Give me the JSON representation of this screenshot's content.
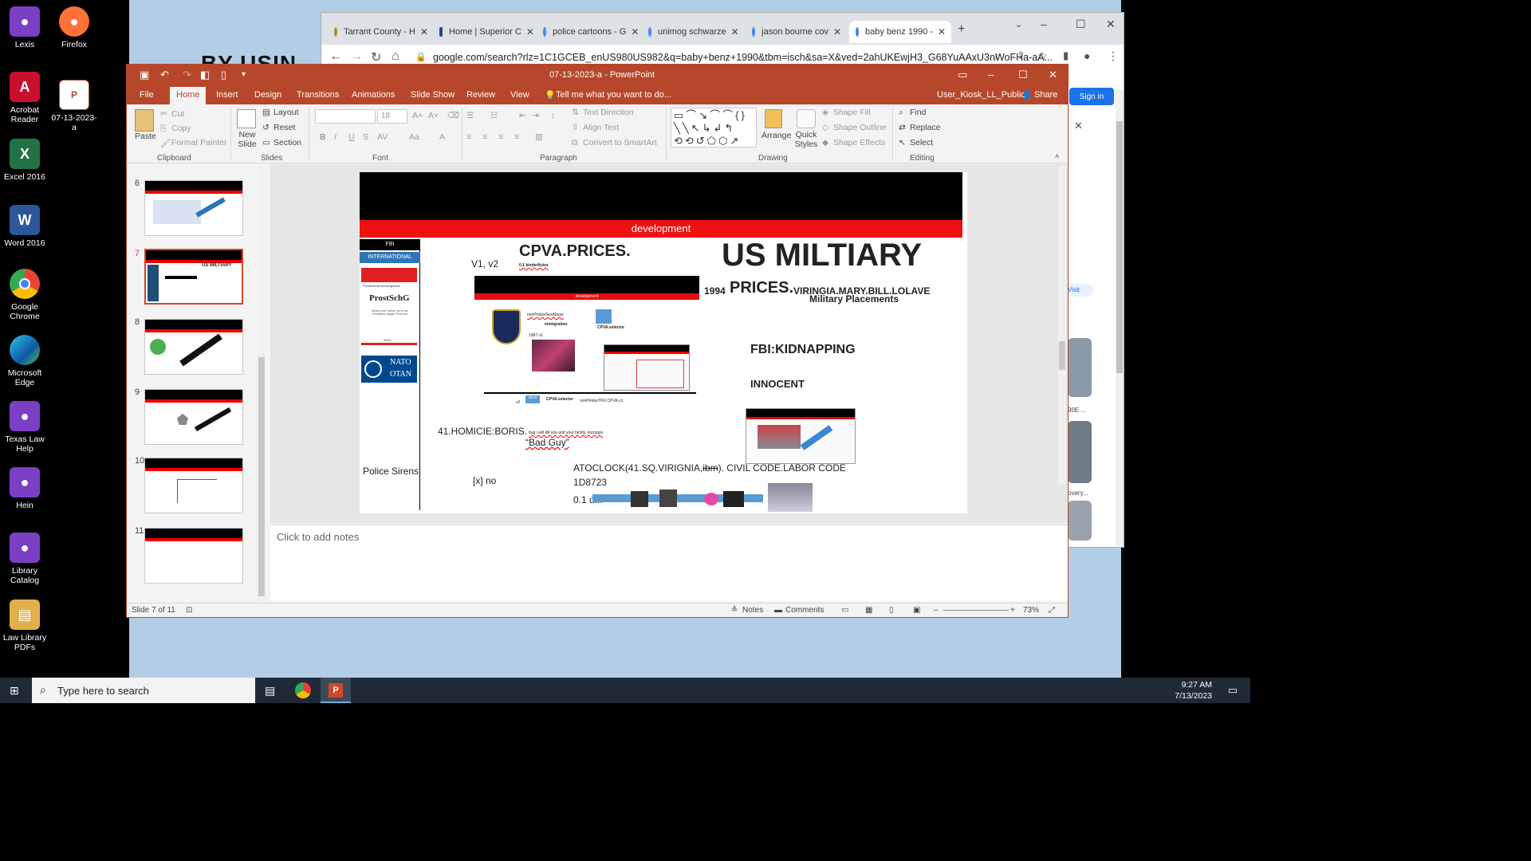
{
  "desktop": {
    "icons": [
      {
        "label": "Lexis",
        "icon": "firefox-icon",
        "color": "#7b3fc4"
      },
      {
        "label": "Firefox",
        "icon": "firefox-icon",
        "color": "#ff7139"
      },
      {
        "label": "Acrobat Reader",
        "icon": "acrobat-icon",
        "color": "#c8102e"
      },
      {
        "label": "07-13-2023-a",
        "icon": "powerpoint-file-icon",
        "color": "#b7472a"
      },
      {
        "label": "Excel 2016",
        "icon": "excel-icon",
        "color": "#217346"
      },
      {
        "label": "Word 2016",
        "icon": "word-icon",
        "color": "#2b579a"
      },
      {
        "label": "Google Chrome",
        "icon": "chrome-icon",
        "color": "#1a73e8"
      },
      {
        "label": "Microsoft Edge",
        "icon": "edge-icon",
        "color": "#0c8ad8"
      },
      {
        "label": "Texas Law Help",
        "icon": "firefox-icon",
        "color": "#7b3fc4"
      },
      {
        "label": "Hein",
        "icon": "firefox-icon",
        "color": "#7b3fc4"
      },
      {
        "label": "Library Catalog",
        "icon": "firefox-icon",
        "color": "#7b3fc4"
      },
      {
        "label": "Law Library PDFs",
        "icon": "pdf-folder-icon",
        "color": "#e2b04a"
      }
    ]
  },
  "chrome": {
    "tabs": [
      {
        "label": "Tarrant County - H"
      },
      {
        "label": "Home | Superior C"
      },
      {
        "label": "police cartoons - G"
      },
      {
        "label": "unimog schwarze"
      },
      {
        "label": "jason bourne cov"
      },
      {
        "label": "baby benz 1990 -"
      }
    ],
    "new_tab": "+",
    "url": "google.com/search?rlz=1C1GCEB_enUS980US982&q=baby+benz+1990&tbm=isch&sa=X&ved=2ahUKEwjH3_G68YuAAxU3nWoFHa-aA...",
    "sign_in": "Sign in",
    "visit": "Visit",
    "side_texts": [
      "90E ...",
      "overy..."
    ]
  },
  "ppt": {
    "title": "07-13-2023-a - PowerPoint",
    "menu": [
      "File",
      "Home",
      "Insert",
      "Design",
      "Transitions",
      "Animations",
      "Slide Show",
      "Review",
      "View"
    ],
    "tell_me": "Tell me what you want to do...",
    "user": "User_Kiosk_LL_Public",
    "share": "Share",
    "ribbon": {
      "paste": "Paste",
      "cut": "Cut",
      "copy": "Copy",
      "format_painter": "Format Painter",
      "clipboard": "Clipboard",
      "new_slide": "New Slide",
      "layout": "Layout",
      "reset": "Reset",
      "section": "Section",
      "slides": "Slides",
      "font_size": "18",
      "font": "Font",
      "text_direction": "Text Direction",
      "align_text": "Align Text",
      "convert_smartart": "Convert to SmartArt",
      "paragraph": "Paragraph",
      "arrange": "Arrange",
      "quick_styles": "Quick Styles",
      "shape_fill": "Shape Fill",
      "shape_outline": "Shape Outline",
      "shape_effects": "Shape Effects",
      "drawing": "Drawing",
      "find": "Find",
      "replace": "Replace",
      "select": "Select",
      "editing": "Editing"
    },
    "thumbnails": [
      {
        "num": "6"
      },
      {
        "num": "7",
        "title": "US MILTIARY"
      },
      {
        "num": "8"
      },
      {
        "num": "9"
      },
      {
        "num": "10"
      },
      {
        "num": "11"
      }
    ],
    "slide": {
      "banner": "development",
      "fbi": "FBI",
      "international": "INTERNATIONAL",
      "prost_header": "Prostituiertenschutzgesetz",
      "prostschg": "ProstSchG",
      "prost_sub": "Gesetz zum Schutz von in der Prostitution tätigen Personen",
      "prost_year": "2023",
      "nato": "NATO",
      "otan": "OTAN",
      "v1v2": "V1, v2",
      "cpva": "CPVA.PRICES.",
      "kinderficker": "0.1 kinderficker",
      "mini_banner": "development",
      "us_military": "US MILTIARY",
      "year": "1994",
      "prices": "PRICES.",
      "virginia": "VIRINGIA.MARY.BILL.LOLAVE",
      "placements": "Military Placements",
      "nonpolice": "nonPolicieSexAbuse",
      "immigration": "immigration",
      "docs": "docs",
      "cpva_selector": "CPVA.selector",
      "num_1987": "1987 v1",
      "fbi_kidnap": "FBI:KIDNAPPING",
      "innocent": "INNOCENT",
      "v2": "v2",
      "docs2": "docs",
      "cpva_selector2": "CPVA.selector",
      "nonpolice2": "nonPolicieTRX.CPVA.v1",
      "homicide": "41.HOMICIE:BORIS.",
      "homicide_small": "bug i will kill you and your family, mzzzpps",
      "bad_guy": "“Bad Guy”",
      "police_sirens": "Police Sirens",
      "x_no": "[x] no",
      "atoclock_a": "ATOCLOCK(41.SQ.VIRIGNIA,",
      "atoclock_b": "ibm",
      "atoclock_c": "). CIVIL CODE.LABOR CODE",
      "code": "1D8723",
      "point_one": "0.1 d..."
    },
    "notes_placeholder": "Click to add notes",
    "status": {
      "slide": "Slide 7 of 11",
      "notes": "Notes",
      "comments": "Comments",
      "zoom": "73%"
    }
  },
  "taskbar": {
    "search": "Type here to search",
    "time": "9:27 AM",
    "date": "7/13/2023"
  }
}
